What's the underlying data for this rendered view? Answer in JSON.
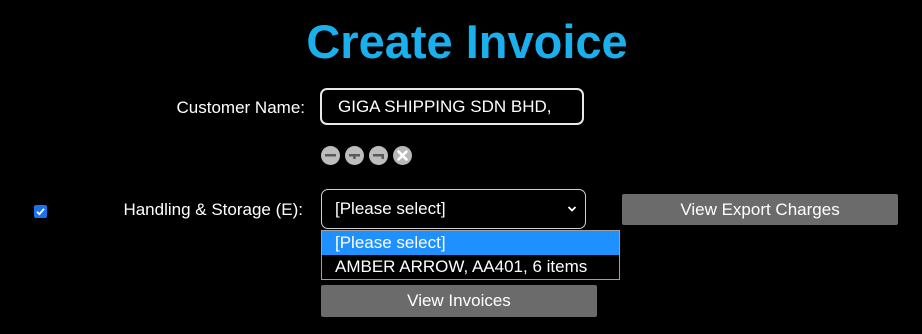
{
  "page": {
    "title": "Create Invoice"
  },
  "customer": {
    "label": "Customer Name:",
    "value": "GIGA SHIPPING SDN BHD,"
  },
  "controls": {
    "icons": [
      "minus-icon",
      "plus-icon",
      "equals-icon",
      "close-icon"
    ]
  },
  "handling": {
    "checked": true,
    "label": "Handling & Storage (E):",
    "selected_value": "[Please select]",
    "options": [
      "[Please select]",
      "AMBER ARROW, AA401, 6 items"
    ]
  },
  "buttons": {
    "view_export_charges": "View Export Charges",
    "view_invoices": "View Invoices"
  },
  "colors": {
    "title": "#1ab0ee",
    "selected_option": "#1e90ff",
    "button": "#6b6b6b",
    "checkbox": "#1a73e8"
  }
}
